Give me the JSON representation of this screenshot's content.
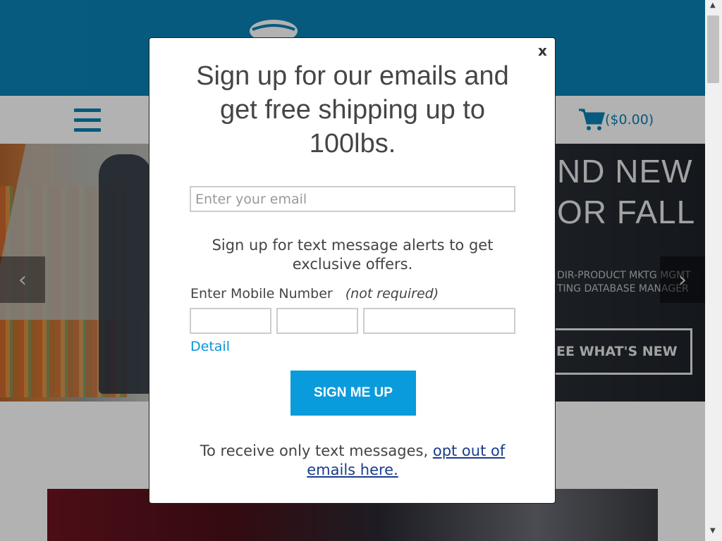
{
  "header": {
    "cart_label": "($0.00)"
  },
  "hero": {
    "title_line1": "ND NEW",
    "title_line2": "OR FALL",
    "sub_line1": "DIR-PRODUCT MKTG MGMT",
    "sub_line2": "TING DATABASE MANAGER",
    "cta_label": "EE WHAT'S NEW",
    "prev_arrow": "‹",
    "next_arrow": "›"
  },
  "modal": {
    "close_label": "x",
    "title": "Sign up for our emails and get free shipping up to 100lbs.",
    "email_placeholder": "Enter your email",
    "sms_text": "Sign up for text message alerts to get exclusive offers.",
    "mobile_label": "Enter Mobile Number",
    "mobile_note": "(not required)",
    "detail_link": "Detail",
    "submit_label": "SIGN ME UP",
    "optout_prefix": "To receive only text messages, ",
    "optout_link": "opt out of emails here."
  },
  "scrollbar": {
    "up_arrow": "▲",
    "down_arrow": "▼"
  },
  "colors": {
    "brand_blue": "#0a82b4",
    "button_blue": "#0a9bdc",
    "link_blue": "#0a94d6"
  }
}
